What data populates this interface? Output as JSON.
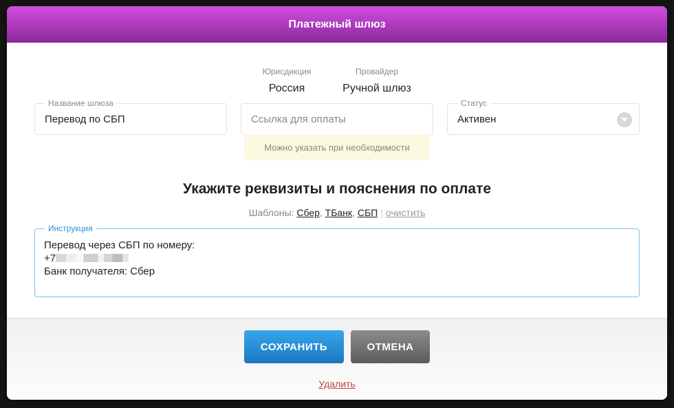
{
  "modal": {
    "title": "Платежный шлюз"
  },
  "info": {
    "jurisdiction_label": "Юрисдикция",
    "jurisdiction_value": "Россия",
    "provider_label": "Провайдер",
    "provider_value": "Ручной шлюз"
  },
  "fields": {
    "gateway_name_label": "Название шлюза",
    "gateway_name_value": "Перевод по СБП",
    "payment_link_placeholder": "Ссылка для оплаты",
    "payment_link_hint": "Можно указать при необходимости",
    "status_label": "Статус",
    "status_value": "Активен"
  },
  "section": {
    "title": "Укажите реквизиты и пояснения по оплате",
    "templates_label": "Шаблоны:",
    "templates": [
      "Сбер",
      "ТБанк",
      "СБП"
    ],
    "clear_label": "очистить"
  },
  "instruction": {
    "label": "Инструкция",
    "line1": "Перевод через СБП по номеру:",
    "line2_prefix": "+7",
    "line3": "Банк получателя: Сбер"
  },
  "footer": {
    "save_label": "СОХРАНИТЬ",
    "cancel_label": "ОТМЕНА",
    "delete_label": "Удалить"
  },
  "colors": {
    "header_top": "#d24ce0",
    "header_bottom": "#8a2a9a",
    "save_button": "#1a78c2",
    "cancel_button": "#5c5c5c",
    "delete_link": "#b84a3c"
  }
}
